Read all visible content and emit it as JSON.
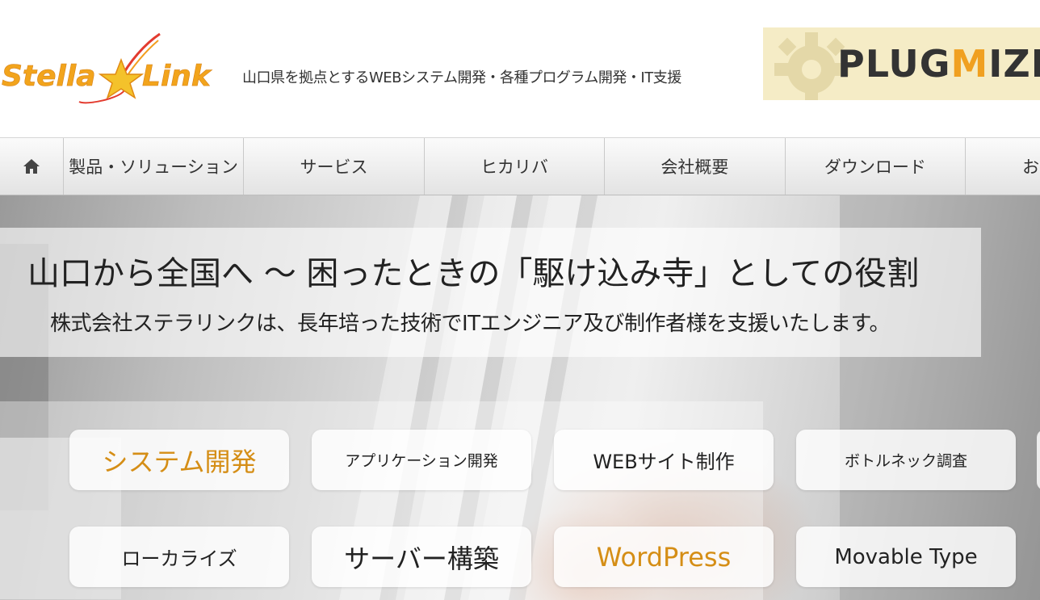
{
  "header": {
    "logo": {
      "text_stella": "Stella",
      "text_link": "Link"
    },
    "tagline": "山口県を拠点とするWEBシステム開発・各種プログラム開発・IT支援",
    "banner": {
      "text_prefix": "PLUG",
      "text_accent": "M",
      "text_suffix": "IZE",
      "accent_color": "#f0a020"
    }
  },
  "nav": {
    "home_icon": "home-icon",
    "items": [
      {
        "label": "製品・ソリューション"
      },
      {
        "label": "サービス"
      },
      {
        "label": "ヒカリバ"
      },
      {
        "label": "会社概要"
      },
      {
        "label": "ダウンロード"
      },
      {
        "label": "お"
      }
    ]
  },
  "hero": {
    "headline": "山口から全国へ ～ 困ったときの「駆け込み寺」としての役割",
    "subline": "株式会社ステラリンクは、長年培った技術でITエンジニア及び制作者様を支援いたします。",
    "tiles": [
      {
        "label": "システム開発"
      },
      {
        "label": "アプリケーション開発"
      },
      {
        "label": "WEBサイト制作"
      },
      {
        "label": "ボトルネック調査"
      },
      {
        "label": "ローカライズ"
      },
      {
        "label": "サーバー構築"
      },
      {
        "label": "WordPress"
      },
      {
        "label": "Movable Type"
      }
    ],
    "accent_color": "#d58e16"
  }
}
